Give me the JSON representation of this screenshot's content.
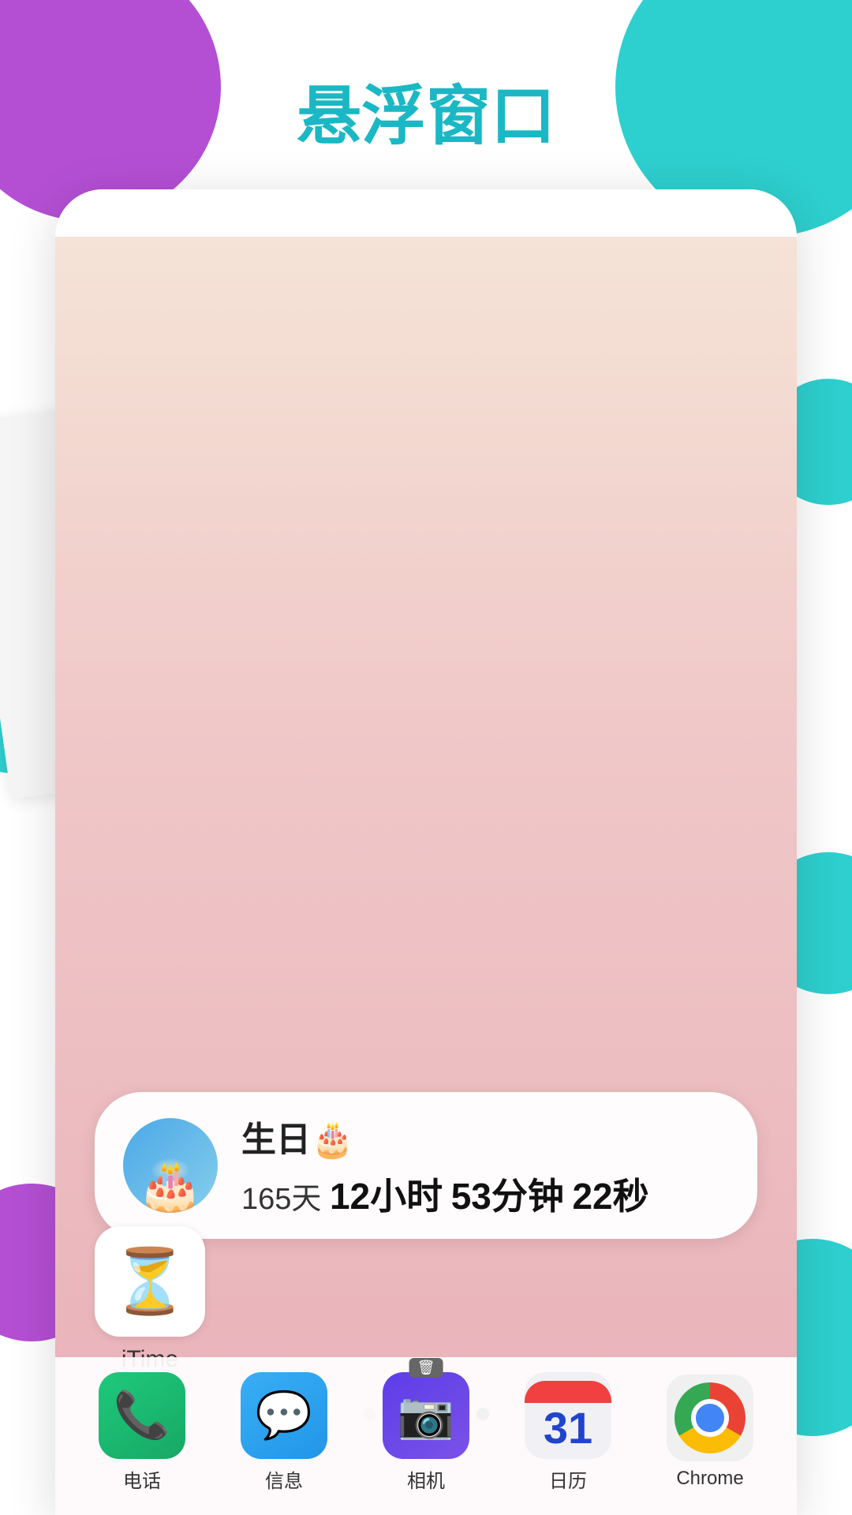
{
  "page": {
    "title": "悬浮窗口",
    "title_color": "#1ab8c4"
  },
  "birthday_widget": {
    "title": "生日🎂",
    "days": "165天",
    "hours": "12小时",
    "minutes": "53分钟",
    "seconds": "22秒"
  },
  "itime_app": {
    "label": "iTime"
  },
  "page_dots": {
    "total": 5,
    "active_index": 4
  },
  "dock_apps": [
    {
      "label": "电话",
      "type": "phone"
    },
    {
      "label": "信息",
      "type": "messages"
    },
    {
      "label": "相机",
      "type": "camera"
    },
    {
      "label": "日历",
      "type": "calendar",
      "day": "31"
    },
    {
      "label": "Chrome",
      "type": "chrome"
    }
  ]
}
